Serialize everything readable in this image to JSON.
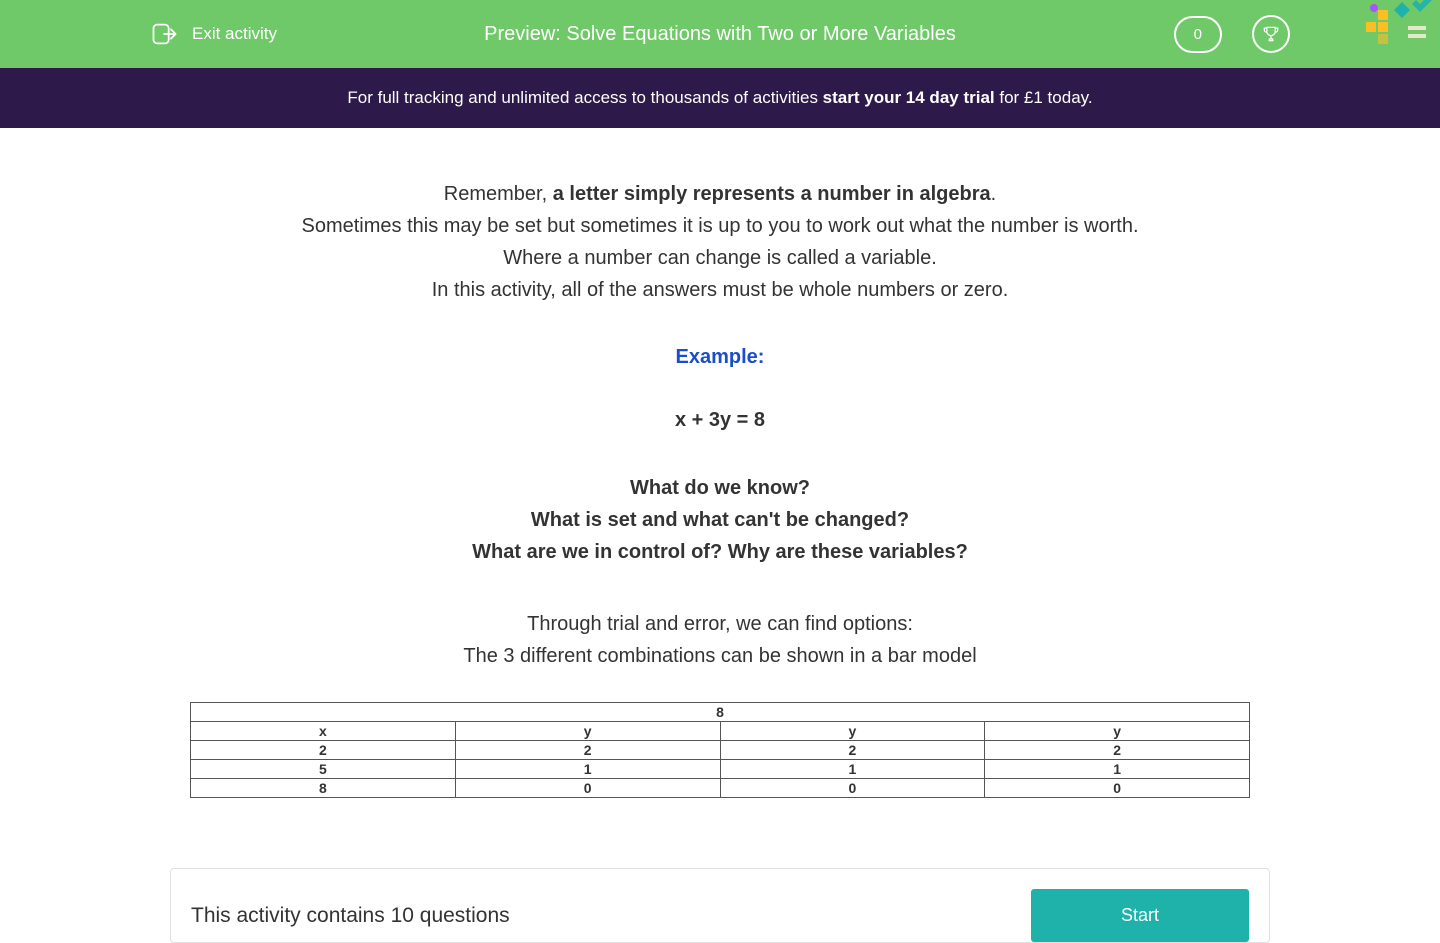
{
  "header": {
    "exit_label": "Exit activity",
    "title": "Preview: Solve Equations with Two or More Variables",
    "score": "0"
  },
  "banner": {
    "prefix": "For full tracking and unlimited access to thousands of activities ",
    "bold": "start your 14 day trial",
    "suffix": " for £1 today."
  },
  "intro": {
    "line1_prefix": "Remember, ",
    "line1_bold": "a letter simply represents a number in algebra",
    "line1_suffix": ".",
    "line2": "Sometimes this may be set but sometimes it is up to you to work out what the number is worth.",
    "line3": "Where a number can change is called a variable.",
    "line4": "In this activity, all of the answers must be whole numbers or zero."
  },
  "example_label": "Example:",
  "equation": "x + 3y = 8 ",
  "questions": {
    "q1": "What do we know?",
    "q2": "What is set and what can't be changed?",
    "q3": "What are we in control of? Why are these variables?"
  },
  "trial": {
    "line1": "Through trial and error, we can find options:",
    "line2": "The 3 different combinations can be shown in a bar model"
  },
  "table": {
    "top": "8",
    "headers": [
      "x",
      "y",
      "y",
      "y"
    ],
    "rows": [
      [
        "2",
        "2",
        "2",
        "2"
      ],
      [
        "5",
        "1",
        "1",
        "1"
      ],
      [
        "8",
        "0",
        "0",
        "0"
      ]
    ]
  },
  "footer": {
    "text": "This activity contains 10 questions",
    "button": "Start"
  }
}
